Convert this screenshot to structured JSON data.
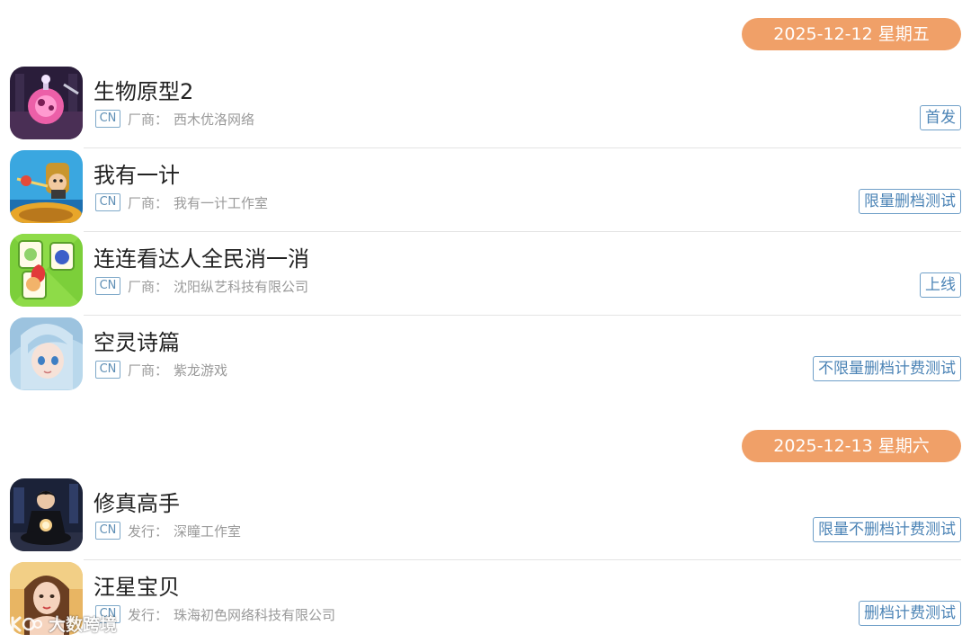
{
  "sections": [
    {
      "date": "2025-12-12 星期五",
      "items": [
        {
          "title": "生物原型2",
          "region": "CN",
          "meta_label": "厂商：",
          "meta_value": "西木优洛网络",
          "tag": "首发",
          "icon": "pink-creature-icon"
        },
        {
          "title": "我有一计",
          "region": "CN",
          "meta_label": "厂商：",
          "meta_value": "我有一计工作室",
          "tag": "限量删档测试",
          "icon": "warrior-character-icon"
        },
        {
          "title": "连连看达人全民消一消",
          "region": "CN",
          "meta_label": "厂商：",
          "meta_value": "沈阳纵艺科技有限公司",
          "tag": "上线",
          "icon": "fruit-tiles-icon"
        },
        {
          "title": "空灵诗篇",
          "region": "CN",
          "meta_label": "厂商：",
          "meta_value": "紫龙游戏",
          "tag": "不限量删档计费测试",
          "icon": "anime-girl-icon"
        }
      ]
    },
    {
      "date": "2025-12-13 星期六",
      "items": [
        {
          "title": "修真高手",
          "region": "CN",
          "meta_label": "发行：",
          "meta_value": "深瞳工作室",
          "tag": "限量不删档计费测试",
          "icon": "meditating-man-icon"
        },
        {
          "title": "汪星宝贝",
          "region": "CN",
          "meta_label": "发行：",
          "meta_value": "珠海初色网络科技有限公司",
          "tag": "删档计费测试",
          "icon": "woman-portrait-icon"
        }
      ]
    }
  ],
  "watermark": {
    "text": "大数跨境"
  },
  "colors": {
    "date_pill": "#f0a068",
    "tag_border": "#6f9fc8",
    "tag_text": "#4c84b6",
    "badge_border": "#7fa9c9"
  }
}
